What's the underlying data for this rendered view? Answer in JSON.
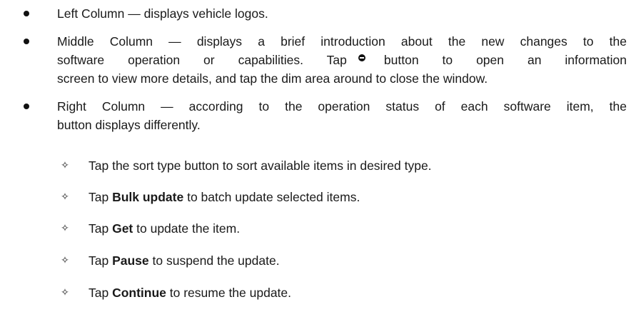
{
  "bullets": [
    {
      "text": "Left Column — displays vehicle logos."
    },
    {
      "line1": "Middle Column — displays a brief introduction about the new changes to the",
      "line2_before": "software operation or capabilities. Tap",
      "line2_after": "button to open an information",
      "line3": "screen to view more details, and tap the dim area around to close the window.",
      "icon": "info-button-icon"
    },
    {
      "line1": "Right Column — according to the operation status of each software item, the",
      "line2": "button displays differently."
    }
  ],
  "sub_items": [
    {
      "prefix": "Tap the sort type button to sort available items in desired type.",
      "bold": "",
      "suffix": ""
    },
    {
      "prefix": "Tap ",
      "bold": "Bulk update",
      "suffix": " to batch update selected items."
    },
    {
      "prefix": "Tap ",
      "bold": "Get",
      "suffix": " to update the item."
    },
    {
      "prefix": "Tap ",
      "bold": "Pause",
      "suffix": " to suspend the update."
    },
    {
      "prefix": "Tap ",
      "bold": "Continue",
      "suffix": " to resume the update."
    }
  ],
  "symbols": {
    "bullet": "●",
    "sub_bullet": "✧"
  }
}
